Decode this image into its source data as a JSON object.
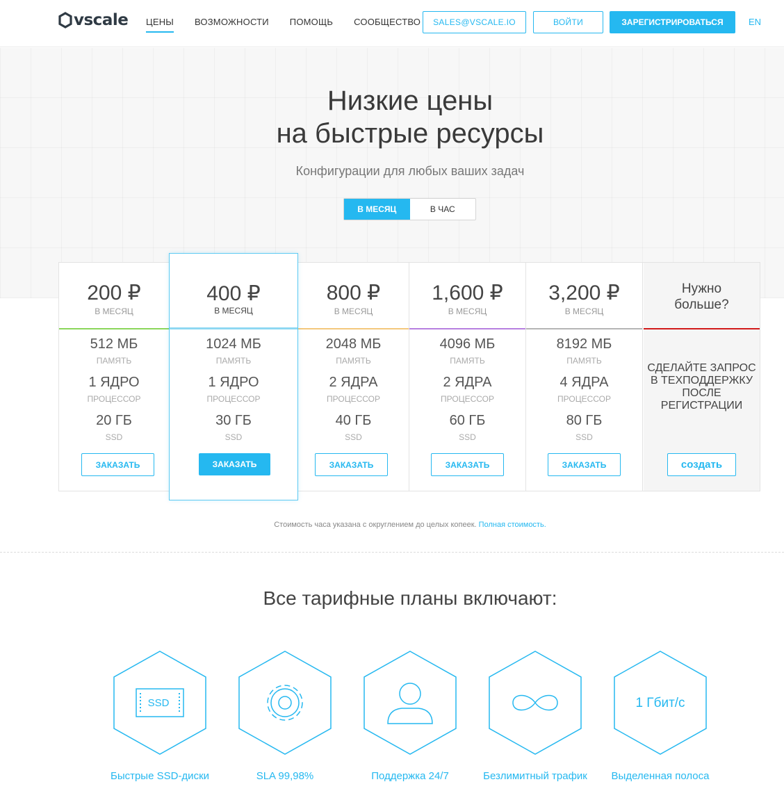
{
  "header": {
    "logo": "vscale",
    "nav": [
      "ЦЕНЫ",
      "ВОЗМОЖНОСТИ",
      "ПОМОЩЬ",
      "СООБЩЕСТВО"
    ],
    "sales_email": "SALES@VSCALE.IO",
    "login": "ВОЙТИ",
    "register": "ЗАРЕГИСТРИРОВАТЬСЯ",
    "lang": "EN"
  },
  "hero": {
    "title_line1": "Низкие цены",
    "title_line2": "на быстрые ресурсы",
    "subtitle": "Конфигурации для любых ваших задач",
    "toggle": [
      "В МЕСЯЦ",
      "В ЧАС"
    ]
  },
  "plans": [
    {
      "price": "200 ₽",
      "period": "В МЕСЯЦ",
      "memory": "512 МБ",
      "memory_label": "ПАМЯТЬ",
      "cpu": "1 ЯДРО",
      "cpu_label": "ПРОЦЕССОР",
      "ssd": "20 ГБ",
      "ssd_label": "SSD",
      "button": "ЗАКАЗАТЬ",
      "color": "#8bd65a"
    },
    {
      "price": "400 ₽",
      "period": "В МЕСЯЦ",
      "memory": "1024 МБ",
      "memory_label": "ПАМЯТЬ",
      "cpu": "1 ЯДРО",
      "cpu_label": "ПРОЦЕССОР",
      "ssd": "30 ГБ",
      "ssd_label": "SSD",
      "button": "ЗАКАЗАТЬ",
      "color": "#8ed8f2"
    },
    {
      "price": "800 ₽",
      "period": "В МЕСЯЦ",
      "memory": "2048 МБ",
      "memory_label": "ПАМЯТЬ",
      "cpu": "2 ЯДРА",
      "cpu_label": "ПРОЦЕССОР",
      "ssd": "40 ГБ",
      "ssd_label": "SSD",
      "button": "ЗАКАЗАТЬ",
      "color": "#f3c77c"
    },
    {
      "price": "1,600 ₽",
      "period": "В МЕСЯЦ",
      "memory": "4096 МБ",
      "memory_label": "ПАМЯТЬ",
      "cpu": "2 ЯДРА",
      "cpu_label": "ПРОЦЕССОР",
      "ssd": "60 ГБ",
      "ssd_label": "SSD",
      "button": "ЗАКАЗАТЬ",
      "color": "#b77fe0"
    },
    {
      "price": "3,200 ₽",
      "period": "В МЕСЯЦ",
      "memory": "8192 МБ",
      "memory_label": "ПАМЯТЬ",
      "cpu": "4 ЯДРА",
      "cpu_label": "ПРОЦЕССОР",
      "ssd": "80 ГБ",
      "ssd_label": "SSD",
      "button": "ЗАКАЗАТЬ",
      "color": "#b5b5b5"
    }
  ],
  "more": {
    "title_line1": "Нужно",
    "title_line2": "больше?",
    "text": "СДЕЛАЙТЕ ЗАПРОС В ТЕХПОДДЕРЖКУ ПОСЛЕ РЕГИСТРАЦИИ",
    "button": "создать",
    "color": "#d11a1a"
  },
  "note": {
    "text": "Стоимость часа указана с округлением до целых копеек.",
    "link": "Полная стоимость."
  },
  "features": {
    "title": "Все тарифные планы включают:",
    "items": [
      {
        "icon": "ssd-icon",
        "icon_text": "SSD",
        "label": "Быстрые SSD-диски"
      },
      {
        "icon": "gear-icon",
        "label": "SLA 99,98%"
      },
      {
        "icon": "user-icon",
        "label": "Поддержка 24/7"
      },
      {
        "icon": "infinity-icon",
        "label": "Безлимитный трафик"
      },
      {
        "icon": "bandwidth-icon",
        "icon_text": "1 Гбит/с",
        "label": "Выделенная полоса"
      }
    ]
  },
  "colors": {
    "accent": "#25b8f0"
  }
}
